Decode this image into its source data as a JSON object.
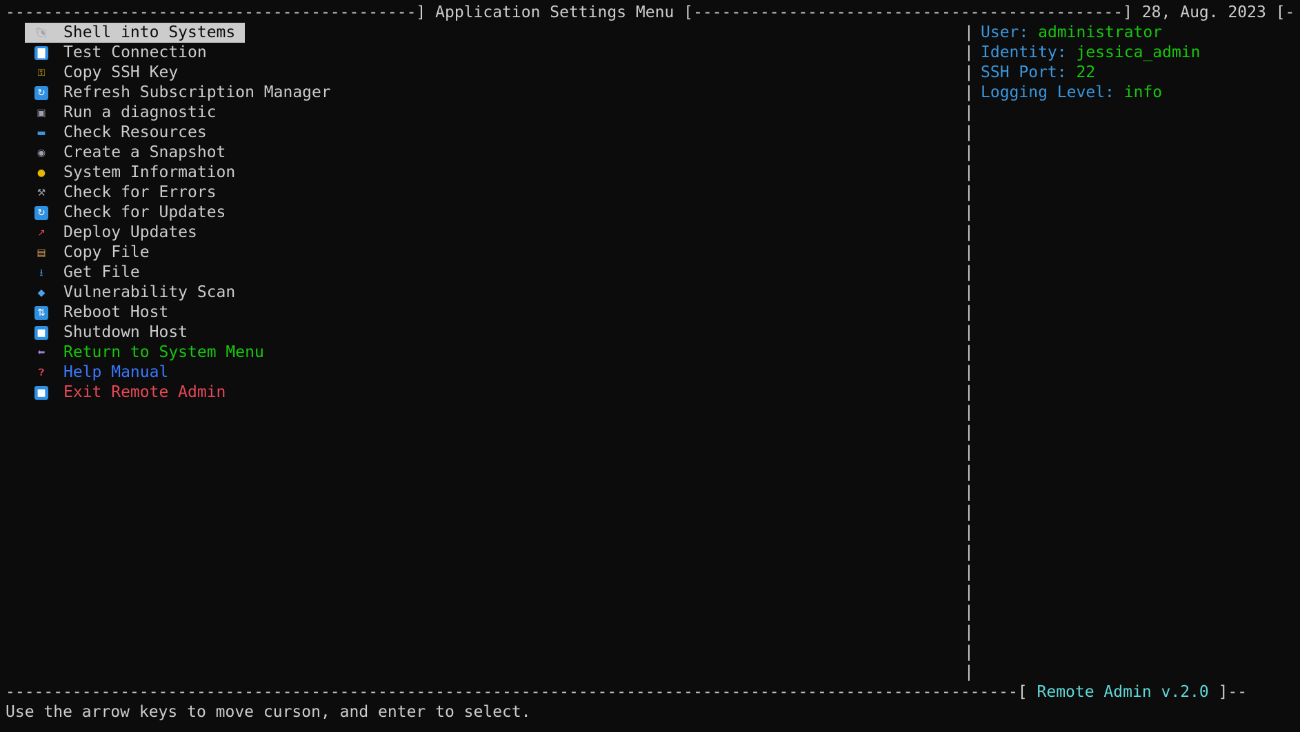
{
  "header": {
    "left_rule": "-------------------------------------------] ",
    "title": "Application Settings Menu",
    "mid_rule": " [---------------------------------------------] ",
    "date": "28, Aug. 2023",
    "right_rule": " [--"
  },
  "menu": {
    "items": [
      {
        "label": "Shell into Systems",
        "icon": "shell-icon",
        "selected": true
      },
      {
        "label": "Test Connection",
        "icon": "bar-chart-icon"
      },
      {
        "label": "Copy SSH Key",
        "icon": "key-icon"
      },
      {
        "label": "Refresh Subscription Manager",
        "icon": "refresh-icon"
      },
      {
        "label": "Run a diagnostic",
        "icon": "floppy-disk-icon"
      },
      {
        "label": "Check Resources",
        "icon": "laptop-icon"
      },
      {
        "label": "Create a Snapshot",
        "icon": "camera-icon"
      },
      {
        "label": "System Information",
        "icon": "lightbulb-icon"
      },
      {
        "label": "Check for Errors",
        "icon": "tools-icon"
      },
      {
        "label": "Check for Updates",
        "icon": "refresh-icon"
      },
      {
        "label": "Deploy Updates",
        "icon": "rocket-icon"
      },
      {
        "label": "Copy File",
        "icon": "clipboard-icon"
      },
      {
        "label": "Get File",
        "icon": "inbox-icon"
      },
      {
        "label": "Vulnerability Scan",
        "icon": "shield-icon"
      },
      {
        "label": "Reboot Host",
        "icon": "repeat-icon"
      },
      {
        "label": "Shutdown Host",
        "icon": "stop-icon"
      },
      {
        "label": "Return to System Menu",
        "icon": "back-arrow-icon",
        "color": "#16c60c"
      },
      {
        "label": "Help Manual",
        "icon": "question-mark-icon",
        "color": "#3b78ff"
      },
      {
        "label": "Exit Remote Admin",
        "icon": "stop-icon",
        "color": "#e74856"
      }
    ]
  },
  "info": {
    "user_key": "User:",
    "user_val": "administrator",
    "identity_key": "Identity:",
    "identity_val": "jessica_admin",
    "port_key": "SSH Port:",
    "port_val": "22",
    "log_key": "Logging Level:",
    "log_val": "info"
  },
  "footer": {
    "rule": "----------------------------------------------------------------------------------------------------------[ ",
    "version": "Remote Admin v.2.0",
    "rule_end": " ]--",
    "hint": "Use the arrow keys to move curson, and enter to select."
  },
  "colors": {
    "background": "#0c0c0c",
    "text": "#cccccc",
    "key": "#3a96dd",
    "value": "#16c60c",
    "accent": "#61d6d6",
    "help": "#3b78ff",
    "exit": "#e74856"
  }
}
